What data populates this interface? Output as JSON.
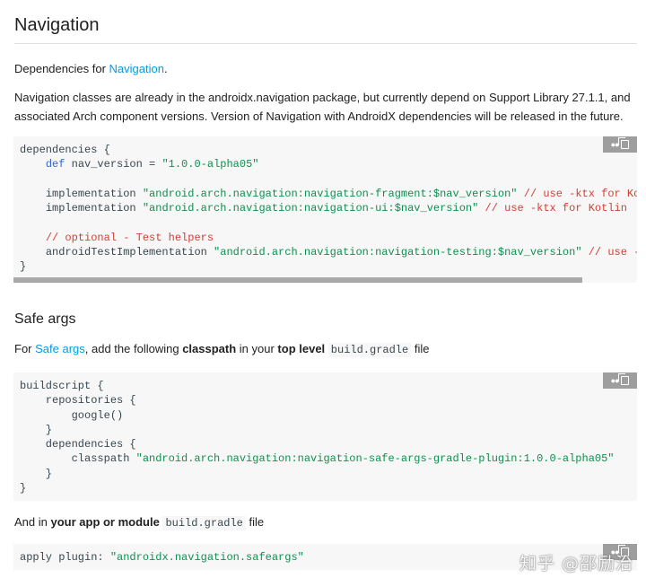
{
  "navigation": {
    "heading": "Navigation",
    "deps_prefix": "Dependencies for ",
    "deps_link": "Navigation",
    "deps_suffix": ".",
    "desc": "Navigation classes are already in the androidx.navigation package, but currently depend on Support Library 27.1.1, and associated Arch component versions. Version of Navigation with AndroidX dependencies will be released in the future.",
    "code": {
      "l1": "dependencies {",
      "l2_kw": "def",
      "l2_var": " nav_version = ",
      "l2_str": "\"1.0.0-alpha05\"",
      "l4_a": "implementation ",
      "l4_str": "\"android.arch.navigation:navigation-fragment:$nav_version\"",
      "l4_cm": " // use -ktx for Kotlin",
      "l5_a": "implementation ",
      "l5_str": "\"android.arch.navigation:navigation-ui:$nav_version\"",
      "l5_cm": " // use -ktx for Kotlin",
      "l7_cm": "// optional - Test helpers",
      "l8_a": "androidTestImplementation ",
      "l8_str": "\"android.arch.navigation:navigation-testing:$nav_version\"",
      "l8_cm": " // use -ktx for Kotlin",
      "l9": "}"
    }
  },
  "safe_args": {
    "heading": "Safe args",
    "p_for": "For ",
    "p_link": "Safe args",
    "p_mid": ", add the following ",
    "p_classpath": "classpath",
    "p_in": " in your ",
    "p_top": "top level",
    "p_file_code": "build.gradle",
    "p_file": " file",
    "code": {
      "l1": "buildscript {",
      "l2": "    repositories {",
      "l3": "        google()",
      "l4": "    }",
      "l5": "    dependencies {",
      "l6_a": "        classpath ",
      "l6_str": "\"android.arch.navigation:navigation-safe-args-gradle-plugin:1.0.0-alpha05\"",
      "l7": "    }",
      "l8": "}"
    },
    "p2_a": "And in ",
    "p2_b": "your app or module",
    "p2_code": "build.gradle",
    "p2_c": " file",
    "code2": {
      "a": "apply plugin: ",
      "str": "\"androidx.navigation.safeargs\""
    }
  },
  "watermark": "知乎 @邵励治",
  "colors": {
    "link": "#039be5",
    "keyword": "#3367d6",
    "string": "#0d904f",
    "comment": "#d23f31",
    "code_bg": "#f7f7f7",
    "copy_button": "#9e9e9e"
  },
  "icons": {
    "copy": "copy-icon"
  }
}
